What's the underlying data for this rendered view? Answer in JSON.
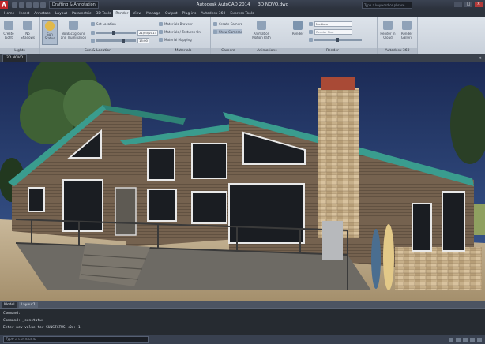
{
  "titlebar": {
    "app_letter": "A",
    "workspace": "Drafting & Annotation",
    "app_name": "Autodesk AutoCAD 2014",
    "file_name": "3D NOVO.dwg",
    "search_placeholder": "Type a keyword or phrase",
    "min": "_",
    "max": "□",
    "close": "×"
  },
  "ribbon_tabs": [
    "Home",
    "Insert",
    "Annotate",
    "Layout",
    "Parametric",
    "3D Tools",
    "Render",
    "View",
    "Manage",
    "Output",
    "Plug-ins",
    "Autodesk 360",
    "Express Tools"
  ],
  "active_tab": "Render",
  "panels": {
    "lights": {
      "title": "Lights",
      "create_light": "Create Light",
      "no_shadows": "No Shadows"
    },
    "sun": {
      "title": "Sun & Location",
      "sun_status": "Sun Status",
      "no_background": "No Background and Illumination",
      "set_location": "Set Location",
      "date": "21/03/2013",
      "time": "15:00"
    },
    "materials": {
      "title": "Materials",
      "browser": "Materials Browser",
      "textures": "Materials / Textures On",
      "mapping": "Material Mapping"
    },
    "camera": {
      "title": "Camera",
      "create": "Create Camera",
      "show": "Show Cameras"
    },
    "animations": {
      "title": "Animations",
      "motion": "Animation Motion Path"
    },
    "render": {
      "title": "Render",
      "render_btn": "Render",
      "quality": "Medium",
      "size": "Render Size"
    },
    "a360": {
      "title": "Autodesk 360",
      "render_cloud": "Render in Cloud",
      "gallery": "Render Gallery"
    }
  },
  "viewport_tab": "3D NOVO",
  "layout_tabs": [
    "Model",
    "Layout1"
  ],
  "active_layout": "Model",
  "command_history": [
    "Command:",
    "Command: _sunstatus",
    "Enter new value for SUNSTATUS <0>: 1"
  ],
  "command_placeholder": "Type a command",
  "colors": {
    "accent": "#c0262a",
    "roof": "#3a9c8e"
  }
}
